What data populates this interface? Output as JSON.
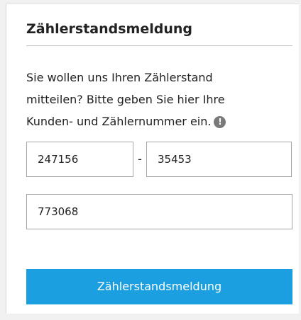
{
  "form": {
    "title": "Zählerstandsmeldung",
    "description_lines": [
      "Sie wollen uns Ihren Zählerstand",
      "mitteilen? Bitte geben Sie hier Ihre",
      "Kunden- und Zählernummer ein."
    ],
    "info_icon": "info-icon",
    "info_glyph": "!",
    "customer_number": "247156",
    "separator": "-",
    "meter_number_part": "35453",
    "meter_number": "773068",
    "submit_label": "Zählerstandsmeldung"
  },
  "colors": {
    "accent": "#1b9fe0",
    "text": "#222222",
    "border": "#a6a6a6"
  }
}
